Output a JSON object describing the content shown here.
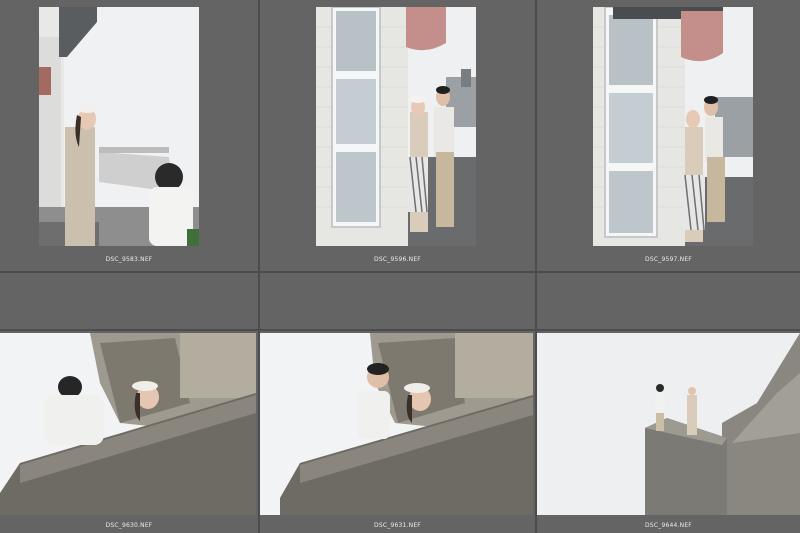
{
  "grid": {
    "thumbnails": [
      {
        "filename": "DSC_9583.NEF"
      },
      {
        "filename": "DSC_9596.NEF"
      },
      {
        "filename": "DSC_9597.NEF"
      },
      {
        "filename": "DSC_9630.NEF"
      },
      {
        "filename": "DSC_9631.NEF"
      },
      {
        "filename": "DSC_9644.NEF"
      }
    ]
  },
  "colors": {
    "background": "#646464",
    "divider": "#4c4c4c",
    "label": "#ececec"
  }
}
